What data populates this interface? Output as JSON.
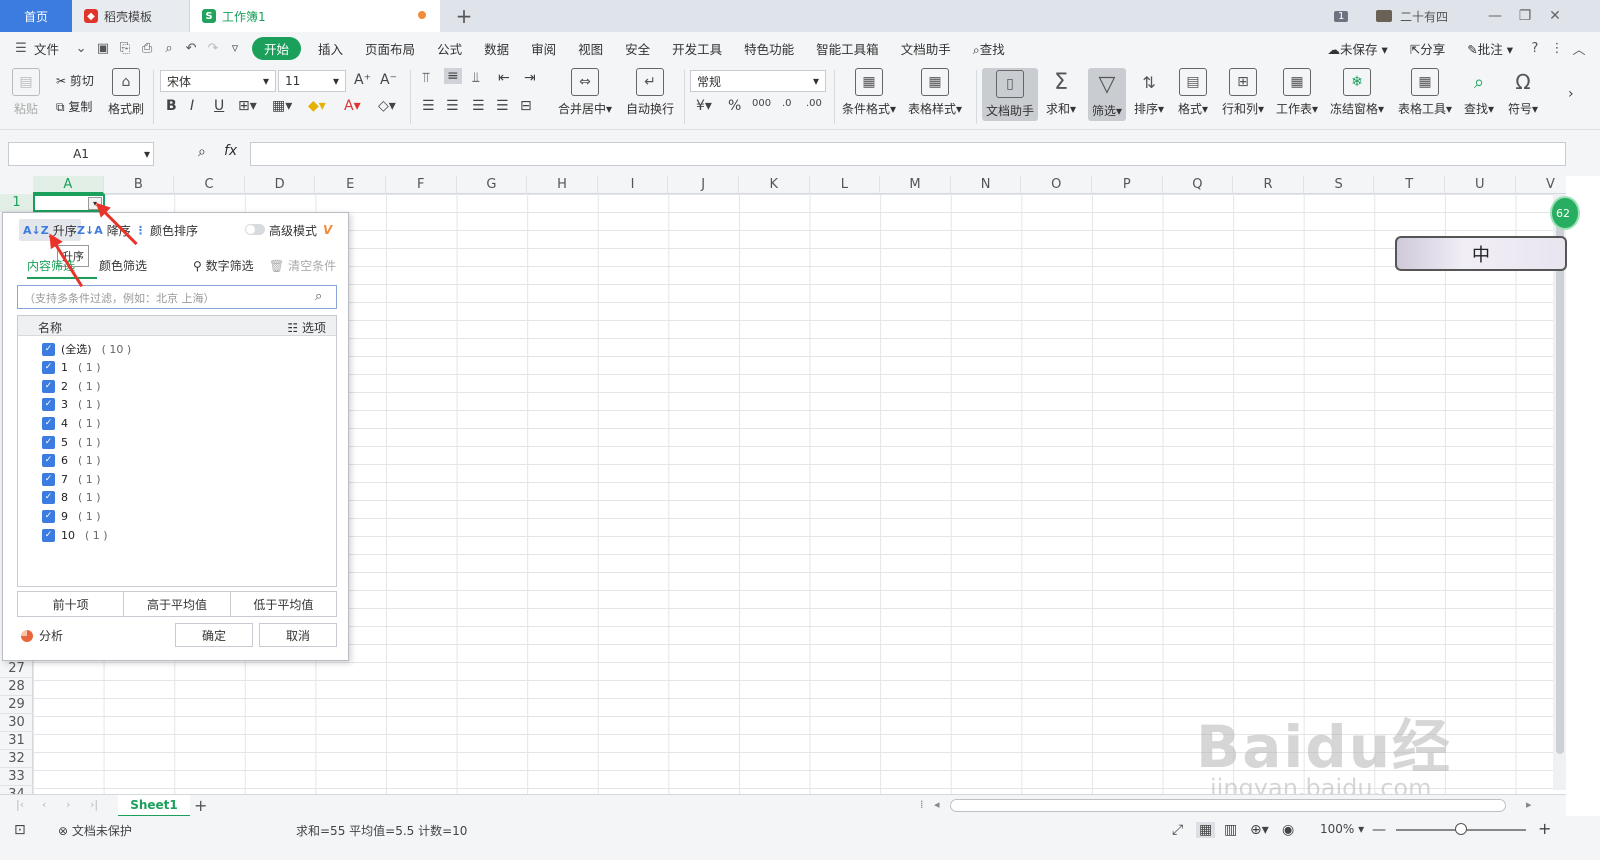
{
  "titlebar": {
    "tabs": [
      "首页",
      "稻壳模板",
      "工作簿1"
    ],
    "new_tab": "+",
    "window_count": "1",
    "user": "二十有四"
  },
  "menubar": {
    "file": "文件",
    "items": [
      "开始",
      "插入",
      "页面布局",
      "公式",
      "数据",
      "审阅",
      "视图",
      "安全",
      "开发工具",
      "特色功能",
      "智能工具箱",
      "文档助手"
    ],
    "search": "查找",
    "unsaved": "未保存",
    "share": "分享",
    "comment": "批注"
  },
  "ribbon": {
    "paste": "粘贴",
    "cut": "剪切",
    "copy": "复制",
    "format_painter": "格式刷",
    "font_name": "宋体",
    "font_size": "11",
    "merge_center": "合并居中",
    "wrap_text": "自动换行",
    "number_format": "常规",
    "conditional_format": "条件格式",
    "table_style": "表格样式",
    "doc_helper": "文档助手",
    "sum": "求和",
    "filter": "筛选",
    "sort": "排序",
    "format": "格式",
    "rows_cols": "行和列",
    "worksheet": "工作表",
    "freeze": "冻结窗格",
    "table_tools": "表格工具",
    "find": "查找",
    "symbol": "符号"
  },
  "formula": {
    "cell_ref": "A1",
    "fx": "fx"
  },
  "grid": {
    "columns": [
      "A",
      "B",
      "C",
      "D",
      "E",
      "F",
      "G",
      "H",
      "I",
      "J",
      "K",
      "L",
      "M",
      "N",
      "O",
      "P",
      "Q",
      "R",
      "S",
      "T",
      "U",
      "V"
    ],
    "rows": [
      "1",
      "27",
      "28",
      "29",
      "30",
      "31",
      "32",
      "33",
      "34"
    ]
  },
  "filter_panel": {
    "sort_asc": "升序",
    "sort_desc": "降序",
    "sort_color": "颜色排序",
    "advanced_mode": "高级模式",
    "tooltip": "升序",
    "tab_content": "内容筛选",
    "tab_color": "颜色筛选",
    "number_filter": "数字筛选",
    "clear_filter": "清空条件",
    "search_placeholder": "（支持多条件过滤，例如：北京  上海）",
    "list_header": "名称",
    "options": "选项",
    "items": [
      {
        "label": "(全选)",
        "count": "( 10 )"
      },
      {
        "label": "1",
        "count": "( 1 )"
      },
      {
        "label": "2",
        "count": "( 1 )"
      },
      {
        "label": "3",
        "count": "( 1 )"
      },
      {
        "label": "4",
        "count": "( 1 )"
      },
      {
        "label": "5",
        "count": "( 1 )"
      },
      {
        "label": "6",
        "count": "( 1 )"
      },
      {
        "label": "7",
        "count": "( 1 )"
      },
      {
        "label": "8",
        "count": "( 1 )"
      },
      {
        "label": "9",
        "count": "( 1 )"
      },
      {
        "label": "10",
        "count": "( 1 )"
      }
    ],
    "top10": "前十项",
    "above_avg": "高于平均值",
    "below_avg": "低于平均值",
    "analyze": "分析",
    "ok": "确定",
    "cancel": "取消"
  },
  "floating": {
    "badge": "62",
    "ime": "中"
  },
  "sheetbar": {
    "sheet": "Sheet1",
    "add": "+"
  },
  "statusbar": {
    "protect": "文档未保护",
    "stats": "求和=55   平均值=5.5   计数=10",
    "zoom": "100%"
  },
  "watermark": {
    "main": "Baidu经验",
    "sub": "jingyan.baidu.com"
  },
  "colors": {
    "accent_green": "#1aa05a",
    "home_blue": "#3c7be0",
    "arrow_red": "#e8332a"
  }
}
